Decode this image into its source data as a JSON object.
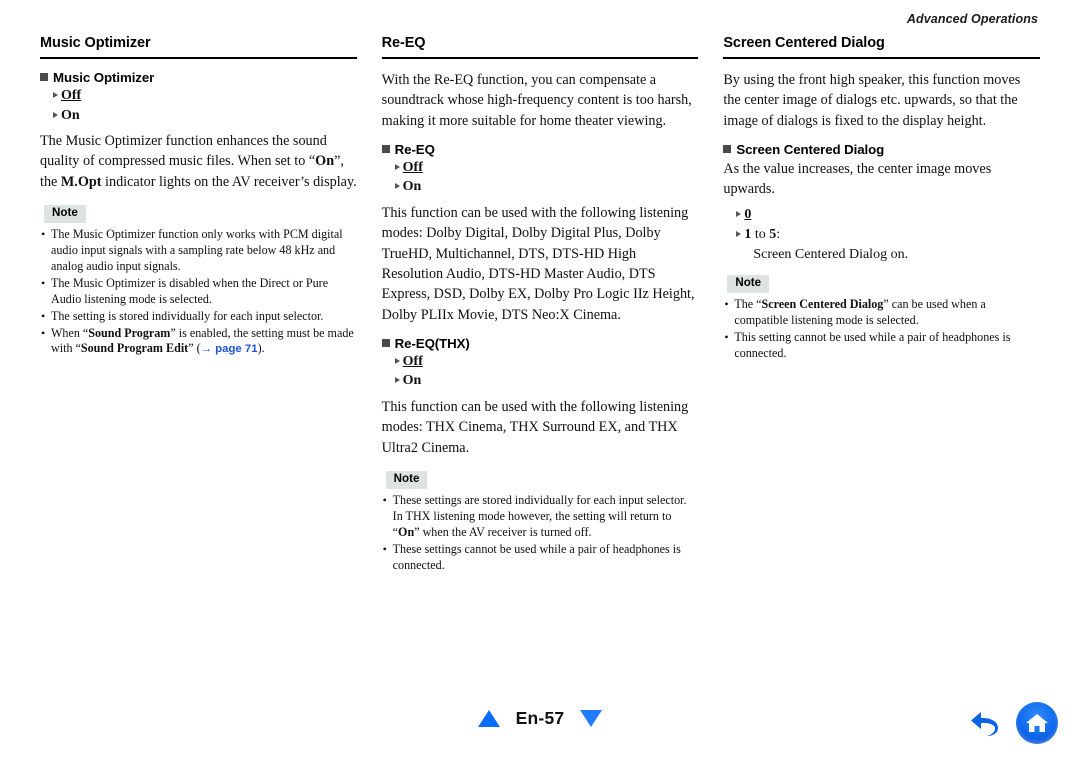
{
  "header": {
    "running_title": "Advanced Operations"
  },
  "footer": {
    "page_label": "En-57",
    "prev_icon": "triangle-up-icon",
    "next_icon": "triangle-down-icon",
    "back_icon": "back-arrow-icon",
    "home_icon": "home-icon",
    "accent_color": "#0a6bff"
  },
  "note_label": "Note",
  "columns": [
    {
      "id": "music-optimizer",
      "title": "Music Optimizer",
      "sub_head": "Music Optimizer",
      "options": [
        {
          "value": "Off",
          "default": true
        },
        {
          "value": "On",
          "default": false
        }
      ],
      "paragraph_1_a": "The Music Optimizer function enhances the sound quality of compressed music files. When set to “",
      "paragraph_1_b": "On",
      "paragraph_1_c": "”, the ",
      "paragraph_1_d": "M.Opt",
      "paragraph_1_e": " indicator lights on the AV receiver’s display.",
      "notes": [
        "The Music Optimizer function only works with PCM digital audio input signals with a sampling rate below 48 kHz and analog audio input signals.",
        "The Music Optimizer is disabled when the Direct or Pure Audio listening mode is selected.",
        "The setting is stored individually for each input selector."
      ],
      "note_last_a": "When “",
      "note_last_b": "Sound Program",
      "note_last_c": "” is enabled, the setting must be made with “",
      "note_last_d": "Sound Program Edit",
      "note_last_e": "” (",
      "note_last_link": "→ page 71",
      "note_last_f": ")."
    },
    {
      "id": "re-eq",
      "title": "Re-EQ",
      "intro": "With the Re-EQ function, you can compensate a soundtrack whose high-frequency content is too harsh, making it more suitable for home theater viewing.",
      "sub_head_1": "Re-EQ",
      "options_1": [
        {
          "value": "Off",
          "default": true
        },
        {
          "value": "On",
          "default": false
        }
      ],
      "paragraph_1": "This function can be used with the following listening modes: Dolby Digital, Dolby Digital Plus, Dolby TrueHD, Multichannel, DTS, DTS-HD High Resolution Audio, DTS-HD Master Audio, DTS Express, DSD, Dolby EX, Dolby Pro Logic IIz Height, Dolby PLIIx Movie, DTS Neo:X Cinema.",
      "sub_head_2": "Re-EQ(THX)",
      "options_2": [
        {
          "value": "Off",
          "default": true
        },
        {
          "value": "On",
          "default": false
        }
      ],
      "paragraph_2": "This function can be used with the following listening modes: THX Cinema, THX Surround EX, and THX Ultra2 Cinema.",
      "note_1_a": "These settings are stored individually for each input selector. In THX listening mode however, the setting will return to “",
      "note_1_b": "On",
      "note_1_c": "” when the AV receiver is turned off.",
      "note_2": "These settings cannot be used while a pair of headphones is connected."
    },
    {
      "id": "screen-centered-dialog",
      "title": "Screen Centered Dialog",
      "intro": "By using the front high speaker, this function moves the center image of dialogs etc. upwards, so that the image of dialogs is fixed to the display height.",
      "sub_head": "Screen Centered Dialog",
      "paragraph": "As the value increases, the center image moves upwards.",
      "option_0": "0",
      "option_range_a": "1",
      "option_range_mid": " to ",
      "option_range_b": "5",
      "option_range_c": ":",
      "option_range_desc": "Screen Centered Dialog on.",
      "note_1_a": "The “",
      "note_1_b": "Screen Centered Dialog",
      "note_1_c": "” can be used when a compatible listening mode is selected.",
      "note_2": "This setting cannot be used while a pair of headphones is connected."
    }
  ]
}
